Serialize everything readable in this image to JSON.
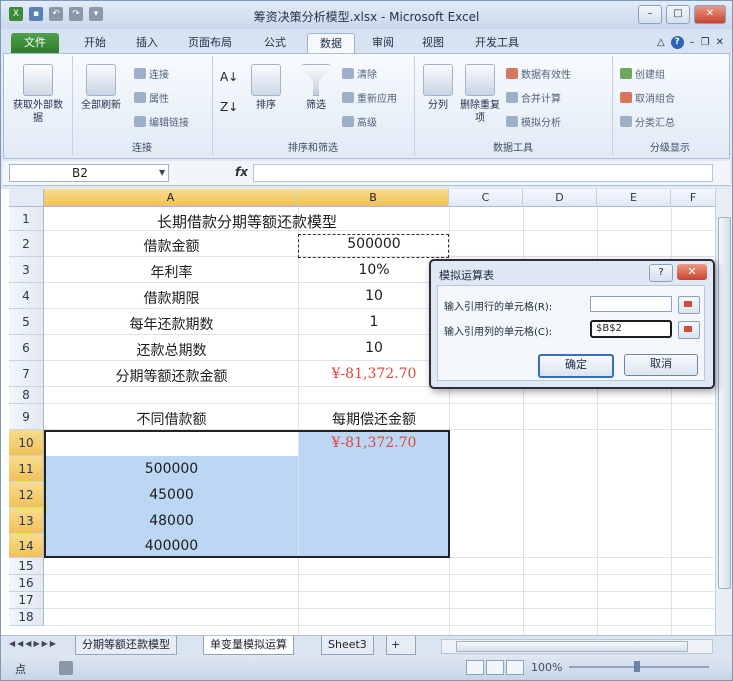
{
  "window": {
    "title": "筹资决策分析模型.xlsx - Microsoft Excel"
  },
  "ribbon": {
    "tabs": [
      "文件",
      "开始",
      "插入",
      "页面布局",
      "公式",
      "数据",
      "审阅",
      "视图",
      "开发工具"
    ],
    "active_tab": "数据",
    "groups": {
      "get_external": {
        "label": "获取外部数据"
      },
      "connections": {
        "label": "连接",
        "refresh_all": "全部刷新",
        "connections": "连接",
        "properties": "属性",
        "edit_links": "编辑链接"
      },
      "sort_filter": {
        "label": "排序和筛选",
        "sort": "排序",
        "filter": "筛选",
        "clear": "清除",
        "reapply": "重新应用",
        "advanced": "高级"
      },
      "data_tools": {
        "label": "数据工具",
        "text_to_columns": "分列",
        "remove_duplicates": "删除重复项",
        "data_validation": "数据有效性",
        "consolidate": "合并计算",
        "what_if": "模拟分析"
      },
      "outline": {
        "label": "分级显示",
        "group": "创建组",
        "ungroup": "取消组合",
        "subtotal": "分类汇总"
      }
    }
  },
  "formula_bar": {
    "name_box": "B2",
    "fx": "fx",
    "formula": ""
  },
  "sheet": {
    "columns": [
      "A",
      "B",
      "C",
      "D",
      "E",
      "F"
    ],
    "rows": [
      "1",
      "2",
      "3",
      "4",
      "5",
      "6",
      "7",
      "8",
      "9",
      "10",
      "11",
      "12",
      "13",
      "14",
      "15",
      "16",
      "17",
      "18"
    ],
    "cells": {
      "A1": "长期借款分期等额还款模型",
      "A2": "借款金额",
      "B2": "500000",
      "A3": "年利率",
      "B3": "10%",
      "A4": "借款期限",
      "B4": "10",
      "A5": "每年还款期数",
      "B5": "1",
      "A6": "还款总期数",
      "B6": "10",
      "A7": "分期等额还款金额",
      "B7": "¥-81,372.70",
      "A9": "不同借款额",
      "B9": "每期偿还金额",
      "B10": "¥-81,372.70",
      "A11": "500000",
      "A12": "45000",
      "A13": "48000",
      "A14": "400000"
    }
  },
  "sheet_tabs": [
    "分期等额还款模型",
    "单变量模拟运算",
    "Sheet3"
  ],
  "active_sheet": "单变量模拟运算",
  "status_bar": {
    "ready": "点",
    "zoom": "100%"
  },
  "dialog": {
    "title": "模拟运算表",
    "help": "?",
    "close": "✕",
    "row_input_label": "输入引用行的单元格(R):",
    "row_input_value": "",
    "col_input_label": "输入引用列的单元格(C):",
    "col_input_value": "$B$2",
    "ok": "确定",
    "cancel": "取消"
  }
}
